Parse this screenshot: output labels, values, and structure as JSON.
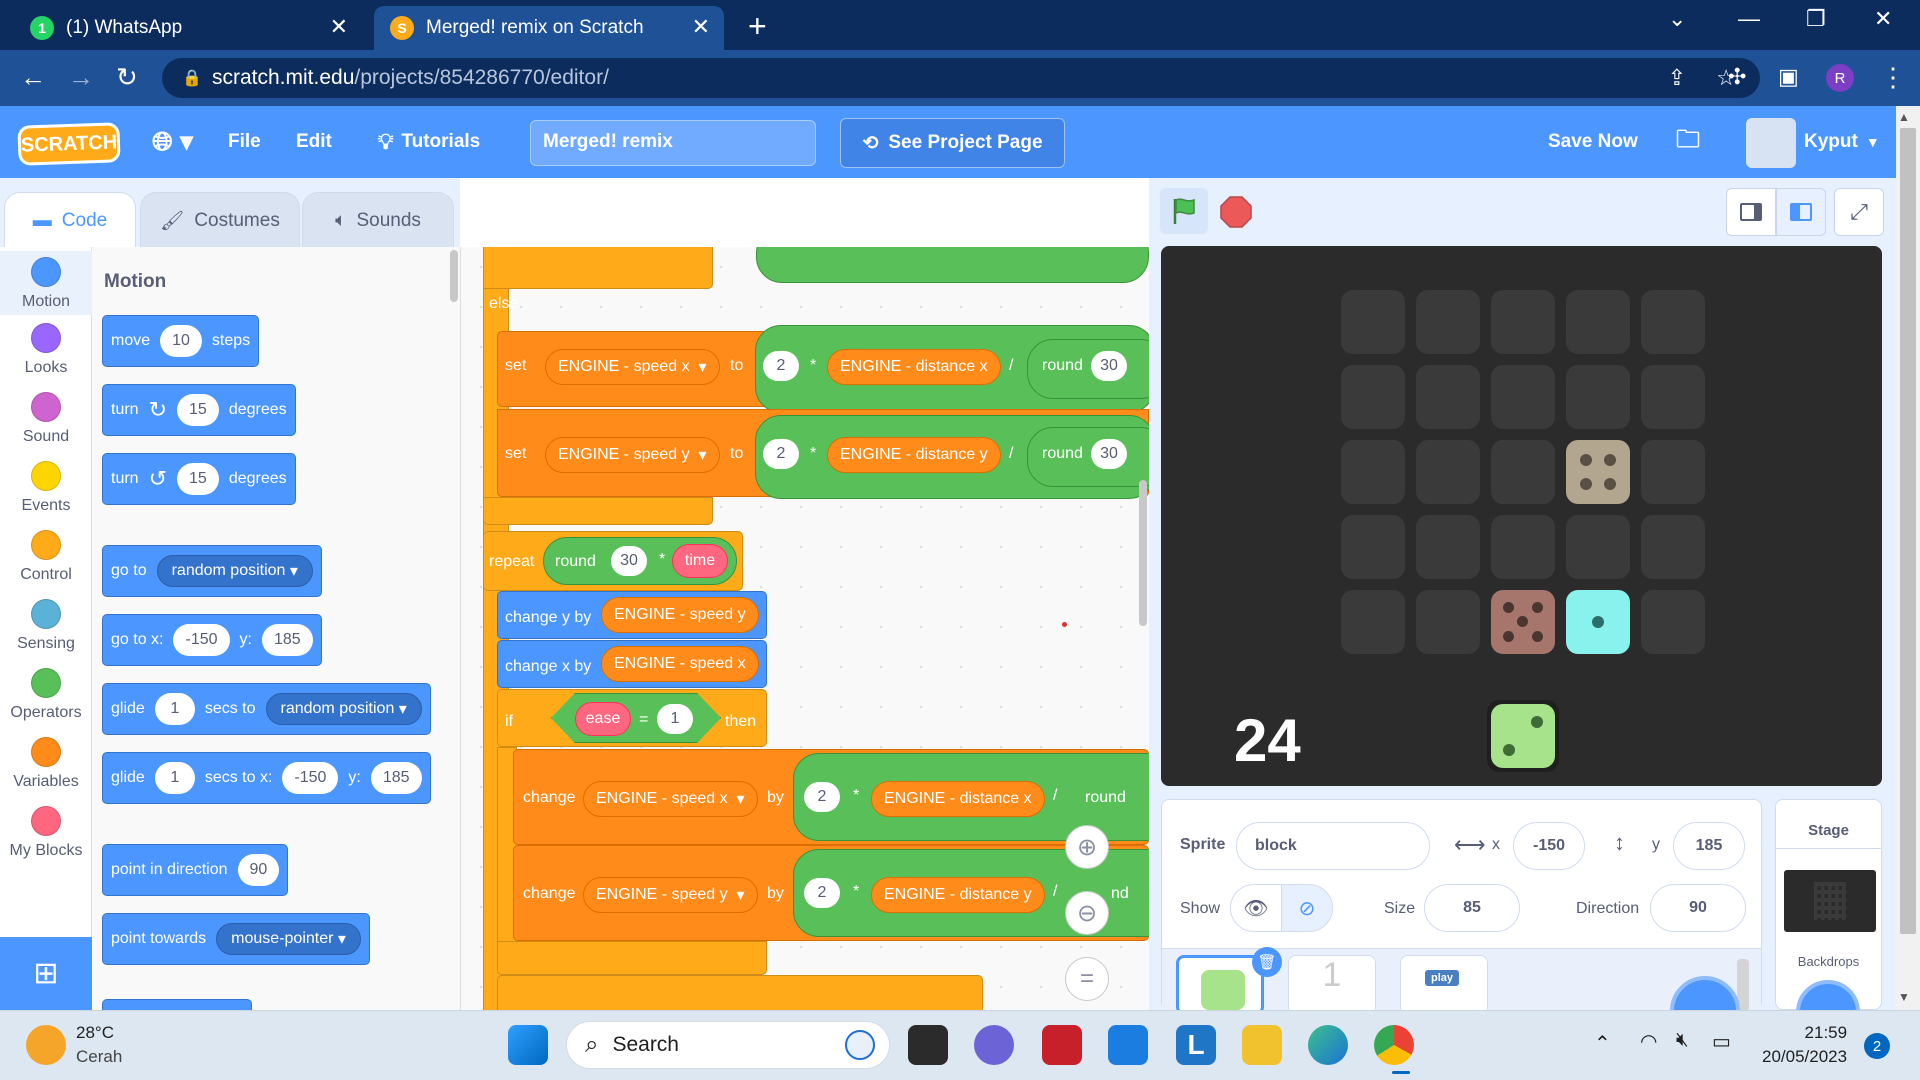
{
  "browser": {
    "tabs": [
      {
        "title": "(1) WhatsApp",
        "icon": "whatsapp-icon",
        "badge": "1"
      },
      {
        "title": "Merged! remix on Scratch",
        "icon": "scratch-icon"
      }
    ],
    "url_host": "scratch.mit.edu",
    "url_path": "/projects/854286770/editor/",
    "profile_initial": "R"
  },
  "menubar": {
    "logo": "SCRATCH",
    "file": "File",
    "edit": "Edit",
    "tutorials": "Tutorials",
    "project_title": "Merged! remix",
    "see_project_page": "See Project Page",
    "save_now": "Save Now",
    "username": "Kyput"
  },
  "editor_tabs": {
    "code": "Code",
    "costumes": "Costumes",
    "sounds": "Sounds"
  },
  "categories": [
    {
      "label": "Motion",
      "color": "#4c97ff"
    },
    {
      "label": "Looks",
      "color": "#9966ff"
    },
    {
      "label": "Sound",
      "color": "#cf63cf"
    },
    {
      "label": "Events",
      "color": "#ffd500"
    },
    {
      "label": "Control",
      "color": "#ffab19"
    },
    {
      "label": "Sensing",
      "color": "#5cb1d6"
    },
    {
      "label": "Operators",
      "color": "#59c059"
    },
    {
      "label": "Variables",
      "color": "#ff8c1a"
    },
    {
      "label": "My Blocks",
      "color": "#ff6680"
    }
  ],
  "palette": {
    "heading": "Motion",
    "move": {
      "a": "move",
      "n": "10",
      "b": "steps"
    },
    "turn_right": {
      "a": "turn",
      "n": "15",
      "b": "degrees"
    },
    "turn_left": {
      "a": "turn",
      "n": "15",
      "b": "degrees"
    },
    "goto": {
      "a": "go to",
      "dd": "random position"
    },
    "gotoxy": {
      "a": "go to x:",
      "x": "-150",
      "yl": "y:",
      "y": "185"
    },
    "glide1": {
      "a": "glide",
      "n": "1",
      "b": "secs to",
      "dd": "random position"
    },
    "glide2": {
      "a": "glide",
      "n": "1",
      "b": "secs to x:",
      "x": "-150",
      "yl": "y:",
      "y": "185"
    },
    "point_dir": {
      "a": "point in direction",
      "n": "90"
    },
    "point_towards": {
      "a": "point towards",
      "dd": "mouse-pointer"
    }
  },
  "script": {
    "else": "else",
    "set1": {
      "a": "set",
      "var": "ENGINE - speed x",
      "to": "to",
      "n": "2",
      "op": "*",
      "rep": "ENGINE - distance x",
      "div": "/",
      "round": "round",
      "r": "30"
    },
    "set2": {
      "a": "set",
      "var": "ENGINE - speed y",
      "to": "to",
      "n": "2",
      "op": "*",
      "rep": "ENGINE - distance y",
      "div": "/",
      "round": "round",
      "r": "30"
    },
    "repeat": {
      "a": "repeat",
      "round": "round",
      "n": "30",
      "op": "*",
      "v": "time"
    },
    "changey": {
      "a": "change y by",
      "rep": "ENGINE - speed y"
    },
    "changex": {
      "a": "change x by",
      "rep": "ENGINE - speed x"
    },
    "if": {
      "a": "if",
      "v": "ease",
      "eq": "=",
      "n": "1",
      "then": "then"
    },
    "change1": {
      "a": "change",
      "var": "ENGINE - speed x",
      "by": "by",
      "n": "2",
      "op": "*",
      "rep": "ENGINE - distance x",
      "div": "/",
      "round": "round"
    },
    "change2": {
      "a": "change",
      "var": "ENGINE - speed y",
      "by": "by",
      "n": "2",
      "op": "*",
      "rep": "ENGINE - distance y",
      "div": "/",
      "round": "nd"
    }
  },
  "stage": {
    "score": "24"
  },
  "sprite_info": {
    "sprite_label": "Sprite",
    "sprite_name": "block",
    "x_label": "x",
    "x": "-150",
    "y_label": "y",
    "y": "185",
    "show_label": "Show",
    "size_label": "Size",
    "size": "85",
    "direction_label": "Direction",
    "direction": "90",
    "sprite_thumb_2": "1",
    "sprite_thumb_3": "play"
  },
  "stage_panel": {
    "title": "Stage",
    "backdrops": "Backdrops"
  },
  "taskbar": {
    "weather_temp": "28°C",
    "weather_desc": "Cerah",
    "search": "Search",
    "time": "21:59",
    "date": "20/05/2023",
    "notifications": "2"
  }
}
